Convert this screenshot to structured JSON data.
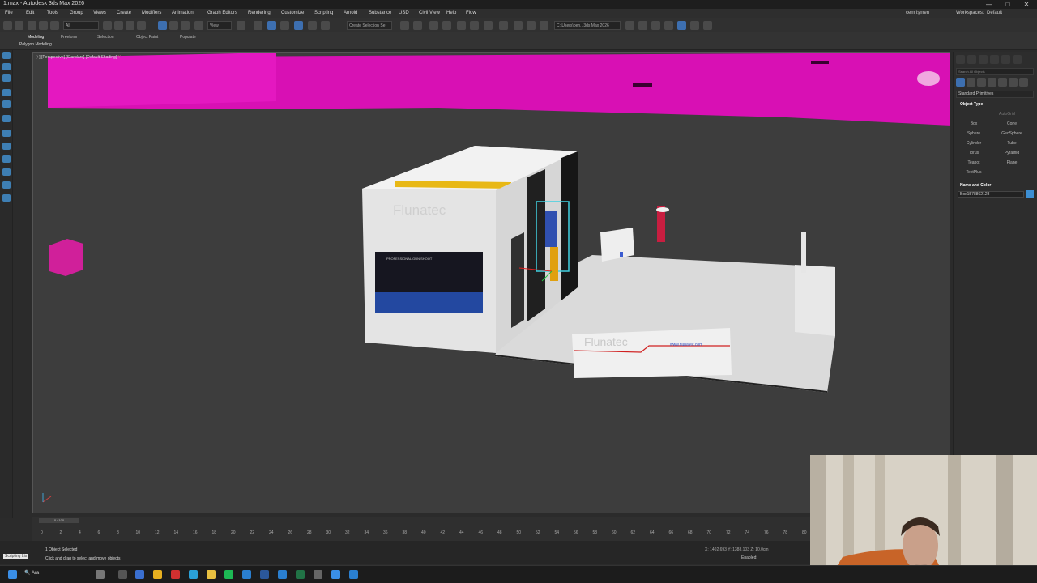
{
  "window": {
    "title": "1.max - Autodesk 3ds Max 2026",
    "controls": [
      "—",
      "□",
      "✕"
    ]
  },
  "menu": {
    "items": [
      "File",
      "Edit",
      "Tools",
      "Group",
      "Views",
      "Create",
      "Modifiers",
      "Animation",
      "Graph Editors",
      "Rendering",
      "Customize",
      "Scripting",
      "Arnold",
      "Substance",
      "USD",
      "Civil View",
      "Help",
      "Flow"
    ],
    "user": "cem işmen",
    "workspaces_label": "Workspaces:",
    "workspace": "Default"
  },
  "toolbar": {
    "filter": "All",
    "view_dropdown": "View",
    "selection_set": "Create Selection Se",
    "project_path": "C:\\Users\\pen...3ds Max 2026"
  },
  "ribbon": {
    "tabs": [
      "Modeling",
      "Freeform",
      "Selection",
      "Object Paint",
      "Populate"
    ],
    "active_tab": "Modeling",
    "panel_label": "Polygon Modeling"
  },
  "viewport": {
    "label": "[+] [Perspective] [Standard] [Default Shading]",
    "label_extra": "Y"
  },
  "scene": {
    "brand_text": "Flunatec",
    "url_text": "www.flunatec.com",
    "screen_text": "PROFESSIONAL GUN SHOOT"
  },
  "command_panel": {
    "search_placeholder": "Search All Objects",
    "category": "Standard Primitives",
    "object_type_header": "Object Type",
    "autogrid": "AutoGrid",
    "buttons": [
      "Box",
      "Cone",
      "Sphere",
      "GeoSphere",
      "Cylinder",
      "Tube",
      "Torus",
      "Pyramid",
      "Teapot",
      "Plane",
      "TextPlus"
    ],
    "name_color_header": "Name and Color",
    "object_name": "Box1578862128"
  },
  "timeline": {
    "frame_display": "0 / 100",
    "ticks": [
      "0",
      "2",
      "4",
      "6",
      "8",
      "10",
      "12",
      "14",
      "16",
      "18",
      "20",
      "22",
      "24",
      "26",
      "28",
      "30",
      "32",
      "34",
      "36",
      "38",
      "40",
      "42",
      "44",
      "46",
      "48",
      "50",
      "52",
      "54",
      "56",
      "58",
      "60",
      "62",
      "64",
      "66",
      "68",
      "70",
      "72",
      "74",
      "76",
      "78",
      "80"
    ]
  },
  "status": {
    "maxscript": "Scripting Lis",
    "selected": "1 Object Selected",
    "prompt": "Click and drag to select and move objects",
    "coords": "X: 1402,693   Y: 1388,103   Z: 10,0cm",
    "grid": "Grid = 10,0cm",
    "enabled": "Enabled:"
  },
  "taskbar": {
    "search": "Ara"
  },
  "colors": {
    "magenta": "#e010b8",
    "selection": "#40d0e0",
    "accent": "#3d6fb0"
  }
}
